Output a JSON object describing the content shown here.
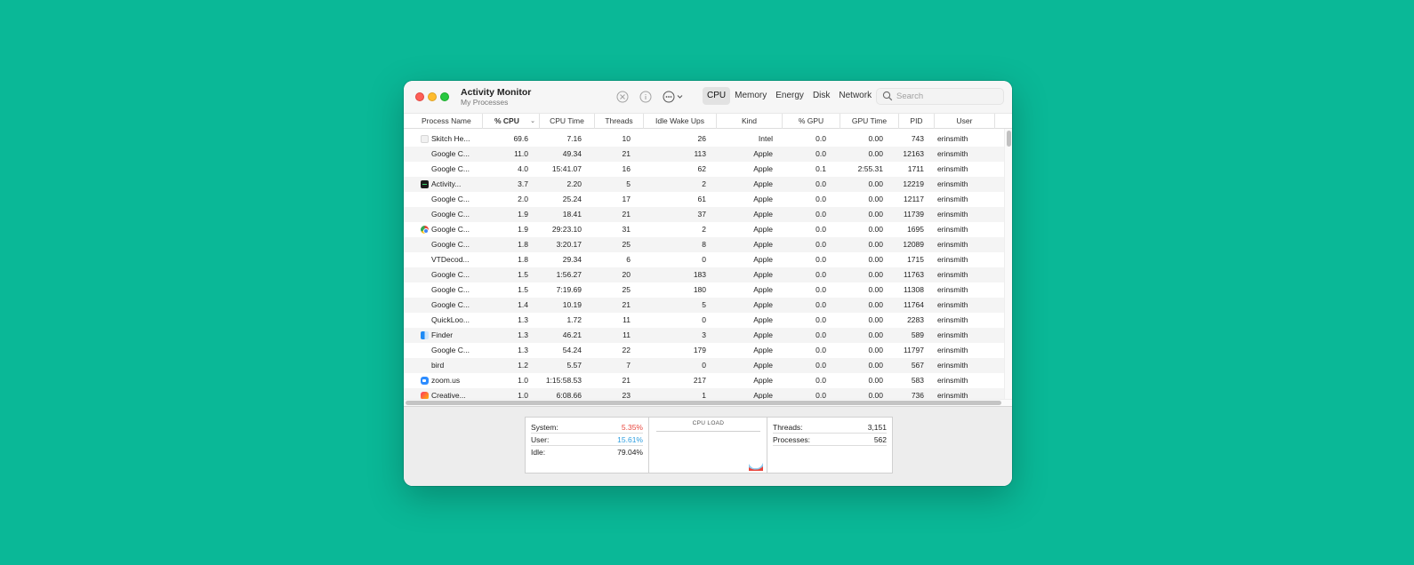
{
  "window": {
    "title": "Activity Monitor",
    "subtitle": "My Processes"
  },
  "toolbar": {
    "tabs": [
      {
        "label": "CPU",
        "active": true
      },
      {
        "label": "Memory",
        "active": false
      },
      {
        "label": "Energy",
        "active": false
      },
      {
        "label": "Disk",
        "active": false
      },
      {
        "label": "Network",
        "active": false
      }
    ],
    "search_placeholder": "Search",
    "icons": [
      "stop-process-icon",
      "info-icon",
      "more-options-icon",
      "search-icon"
    ]
  },
  "table": {
    "columns": [
      "Process Name",
      "% CPU",
      "CPU Time",
      "Threads",
      "Idle Wake Ups",
      "Kind",
      "% GPU",
      "GPU Time",
      "PID",
      "User"
    ],
    "sort_column": "% CPU",
    "rows": [
      {
        "icon": "blank-doc",
        "name": "Skitch He...",
        "cpu": "69.6",
        "cpu_time": "7.16",
        "threads": "10",
        "idle_wake_ups": "26",
        "kind": "Intel",
        "gpu": "0.0",
        "gpu_time": "0.00",
        "pid": "743",
        "user": "erinsmith"
      },
      {
        "icon": "",
        "name": "Google C...",
        "cpu": "11.0",
        "cpu_time": "49.34",
        "threads": "21",
        "idle_wake_ups": "113",
        "kind": "Apple",
        "gpu": "0.0",
        "gpu_time": "0.00",
        "pid": "12163",
        "user": "erinsmith"
      },
      {
        "icon": "",
        "name": "Google C...",
        "cpu": "4.0",
        "cpu_time": "15:41.07",
        "threads": "16",
        "idle_wake_ups": "62",
        "kind": "Apple",
        "gpu": "0.1",
        "gpu_time": "2:55.31",
        "pid": "1711",
        "user": "erinsmith"
      },
      {
        "icon": "activity-monitor",
        "name": "Activity...",
        "cpu": "3.7",
        "cpu_time": "2.20",
        "threads": "5",
        "idle_wake_ups": "2",
        "kind": "Apple",
        "gpu": "0.0",
        "gpu_time": "0.00",
        "pid": "12219",
        "user": "erinsmith"
      },
      {
        "icon": "",
        "name": "Google C...",
        "cpu": "2.0",
        "cpu_time": "25.24",
        "threads": "17",
        "idle_wake_ups": "61",
        "kind": "Apple",
        "gpu": "0.0",
        "gpu_time": "0.00",
        "pid": "12117",
        "user": "erinsmith"
      },
      {
        "icon": "",
        "name": "Google C...",
        "cpu": "1.9",
        "cpu_time": "18.41",
        "threads": "21",
        "idle_wake_ups": "37",
        "kind": "Apple",
        "gpu": "0.0",
        "gpu_time": "0.00",
        "pid": "11739",
        "user": "erinsmith"
      },
      {
        "icon": "chrome",
        "name": "Google C...",
        "cpu": "1.9",
        "cpu_time": "29:23.10",
        "threads": "31",
        "idle_wake_ups": "2",
        "kind": "Apple",
        "gpu": "0.0",
        "gpu_time": "0.00",
        "pid": "1695",
        "user": "erinsmith"
      },
      {
        "icon": "",
        "name": "Google C...",
        "cpu": "1.8",
        "cpu_time": "3:20.17",
        "threads": "25",
        "idle_wake_ups": "8",
        "kind": "Apple",
        "gpu": "0.0",
        "gpu_time": "0.00",
        "pid": "12089",
        "user": "erinsmith"
      },
      {
        "icon": "",
        "name": "VTDecod...",
        "cpu": "1.8",
        "cpu_time": "29.34",
        "threads": "6",
        "idle_wake_ups": "0",
        "kind": "Apple",
        "gpu": "0.0",
        "gpu_time": "0.00",
        "pid": "1715",
        "user": "erinsmith"
      },
      {
        "icon": "",
        "name": "Google C...",
        "cpu": "1.5",
        "cpu_time": "1:56.27",
        "threads": "20",
        "idle_wake_ups": "183",
        "kind": "Apple",
        "gpu": "0.0",
        "gpu_time": "0.00",
        "pid": "11763",
        "user": "erinsmith"
      },
      {
        "icon": "",
        "name": "Google C...",
        "cpu": "1.5",
        "cpu_time": "7:19.69",
        "threads": "25",
        "idle_wake_ups": "180",
        "kind": "Apple",
        "gpu": "0.0",
        "gpu_time": "0.00",
        "pid": "11308",
        "user": "erinsmith"
      },
      {
        "icon": "",
        "name": "Google C...",
        "cpu": "1.4",
        "cpu_time": "10.19",
        "threads": "21",
        "idle_wake_ups": "5",
        "kind": "Apple",
        "gpu": "0.0",
        "gpu_time": "0.00",
        "pid": "11764",
        "user": "erinsmith"
      },
      {
        "icon": "",
        "name": "QuickLoo...",
        "cpu": "1.3",
        "cpu_time": "1.72",
        "threads": "11",
        "idle_wake_ups": "0",
        "kind": "Apple",
        "gpu": "0.0",
        "gpu_time": "0.00",
        "pid": "2283",
        "user": "erinsmith"
      },
      {
        "icon": "finder",
        "name": "Finder",
        "cpu": "1.3",
        "cpu_time": "46.21",
        "threads": "11",
        "idle_wake_ups": "3",
        "kind": "Apple",
        "gpu": "0.0",
        "gpu_time": "0.00",
        "pid": "589",
        "user": "erinsmith"
      },
      {
        "icon": "",
        "name": "Google C...",
        "cpu": "1.3",
        "cpu_time": "54.24",
        "threads": "22",
        "idle_wake_ups": "179",
        "kind": "Apple",
        "gpu": "0.0",
        "gpu_time": "0.00",
        "pid": "11797",
        "user": "erinsmith"
      },
      {
        "icon": "",
        "name": "bird",
        "cpu": "1.2",
        "cpu_time": "5.57",
        "threads": "7",
        "idle_wake_ups": "0",
        "kind": "Apple",
        "gpu": "0.0",
        "gpu_time": "0.00",
        "pid": "567",
        "user": "erinsmith"
      },
      {
        "icon": "zoom",
        "name": "zoom.us",
        "cpu": "1.0",
        "cpu_time": "1:15:58.53",
        "threads": "21",
        "idle_wake_ups": "217",
        "kind": "Apple",
        "gpu": "0.0",
        "gpu_time": "0.00",
        "pid": "583",
        "user": "erinsmith"
      },
      {
        "icon": "creative-cloud",
        "name": "Creative...",
        "cpu": "1.0",
        "cpu_time": "6:08.66",
        "threads": "23",
        "idle_wake_ups": "1",
        "kind": "Apple",
        "gpu": "0.0",
        "gpu_time": "0.00",
        "pid": "736",
        "user": "erinsmith"
      }
    ]
  },
  "stats": {
    "system_label": "System:",
    "system_value": "5.35%",
    "user_label": "User:",
    "user_value": "15.61%",
    "idle_label": "Idle:",
    "idle_value": "79.04%",
    "cpu_load_title": "CPU LOAD",
    "threads_label": "Threads:",
    "threads_value": "3,151",
    "processes_label": "Processes:",
    "processes_value": "562"
  },
  "colors": {
    "background": "#0ab897",
    "system": "#e8453c",
    "user": "#2f9fe0"
  }
}
